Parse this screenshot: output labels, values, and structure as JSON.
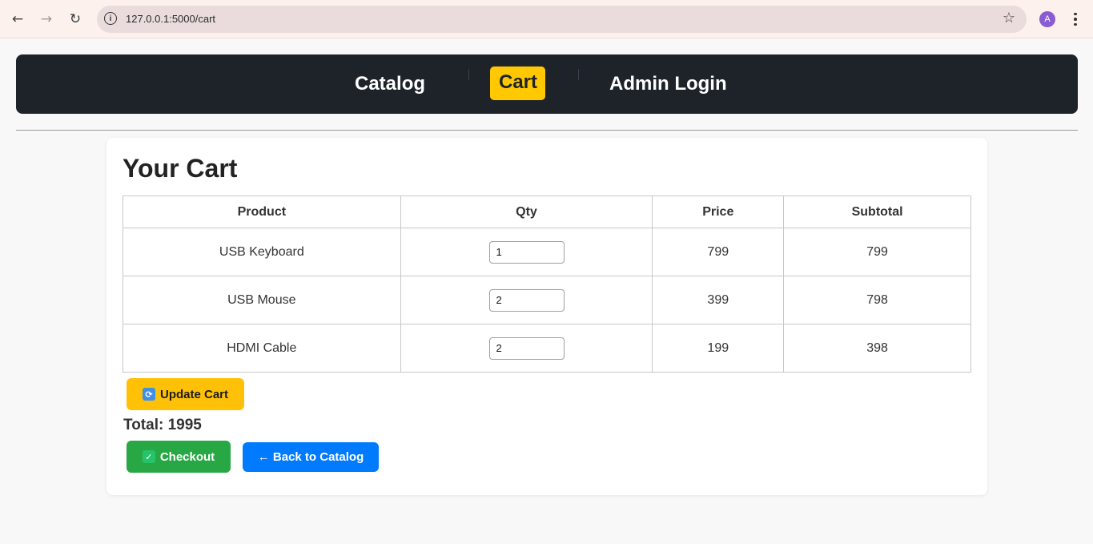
{
  "browser": {
    "url": "127.0.0.1:5000/cart",
    "profile_initial": "A"
  },
  "nav": {
    "catalog": "Catalog",
    "cart": "Cart",
    "admin_login": "Admin Login"
  },
  "page": {
    "title": "Your Cart"
  },
  "table": {
    "headers": [
      "Product",
      "Qty",
      "Price",
      "Subtotal"
    ],
    "rows": [
      {
        "product": "USB Keyboard",
        "qty": "1",
        "price": "799",
        "subtotal": "799"
      },
      {
        "product": "USB Mouse",
        "qty": "2",
        "price": "399",
        "subtotal": "798"
      },
      {
        "product": "HDMI Cable",
        "qty": "2",
        "price": "199",
        "subtotal": "398"
      }
    ]
  },
  "actions": {
    "update_label": "Update Cart",
    "total_text": "Total: 1995",
    "checkout_label": "Checkout",
    "back_label": "← Back to Catalog"
  },
  "colors": {
    "nav_bg": "#1e232a",
    "accent_yellow": "#ffc800",
    "success_green": "#28a745",
    "primary_blue": "#007bff"
  }
}
